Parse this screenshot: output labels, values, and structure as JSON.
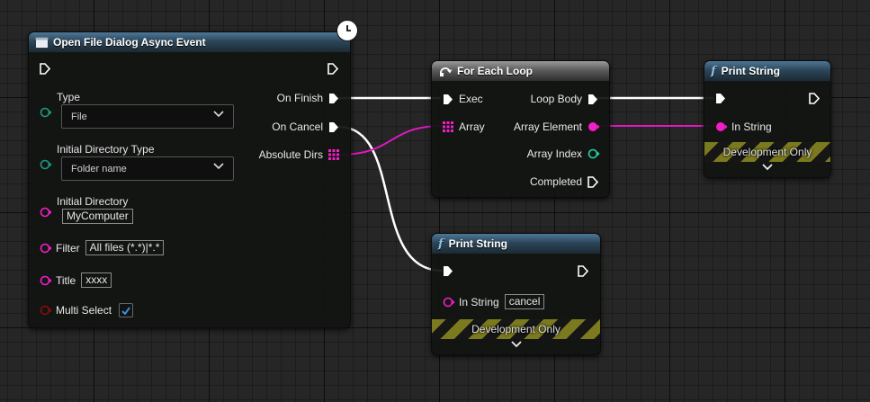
{
  "colors": {
    "exec": "#ffffff",
    "string_pin": "#f21ec8",
    "byte_pin": "#1d9a80",
    "bool_pin": "#8f0a0a",
    "array_pin": "#f21ec8",
    "header_blue": "#2c465a",
    "header_gray": "#5c5c5c",
    "wire_exec": "#ffffff",
    "wire_string": "#e018c2"
  },
  "icons": {
    "event_icon": "window-icon",
    "latent_icon": "clock-icon",
    "loop_icon": "loop-icon",
    "function_icon": "function-icon"
  },
  "open_dialog": {
    "title": "Open File Dialog Async Event",
    "type_label": "Type",
    "type_value": "File",
    "initial_dir_type_label": "Initial Directory Type",
    "initial_dir_type_value": "Folder name",
    "initial_dir_label": "Initial Directory",
    "initial_dir_value": "MyComputer",
    "filter_label": "Filter",
    "filter_value": "All files (*.*)|*.*",
    "title_label": "Title",
    "title_value": "xxxx",
    "multi_select_label": "Multi Select",
    "multi_select_checked": true,
    "on_finish": "On Finish",
    "on_cancel": "On Cancel",
    "absolute_dirs": "Absolute Dirs"
  },
  "for_each": {
    "title": "For Each Loop",
    "exec": "Exec",
    "array": "Array",
    "loop_body": "Loop Body",
    "array_element": "Array Element",
    "array_index": "Array Index",
    "completed": "Completed"
  },
  "print_top": {
    "title": "Print String",
    "in_string": "In String",
    "dev_only": "Development Only"
  },
  "print_bottom": {
    "title": "Print String",
    "in_string": "In String",
    "in_string_value": "cancel",
    "dev_only": "Development Only"
  }
}
